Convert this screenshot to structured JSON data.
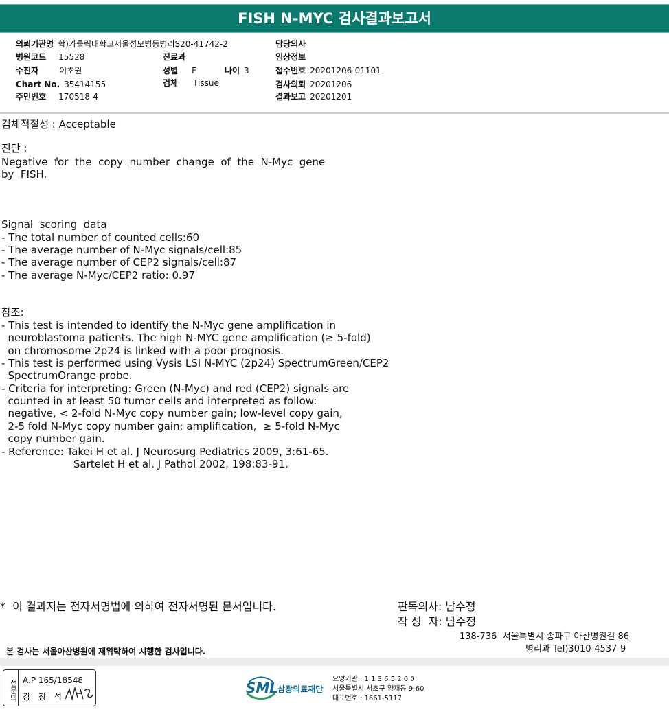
{
  "title": "FISH N-MYC 검사결과보고서",
  "info": {
    "req_inst_label": "의뢰기관명",
    "req_inst_value": "학)가톨릭대학교서울성모병동병리S20-41742-2",
    "hosp_code_label": "병원코드",
    "hosp_code_value": "15528",
    "patient_label": "수진자",
    "patient_value": "이초원",
    "chart_label": "Chart No.",
    "chart_value": "35414155",
    "id_label": "주민번호",
    "id_value": "170518-4",
    "dept_label": "진료과",
    "dept_value": "",
    "sex_label": "성별",
    "sex_value": "F",
    "age_label": "나이",
    "age_value": "3",
    "specimen_label": "검체",
    "specimen_value": "Tissue",
    "doctor_label": "담당의사",
    "doctor_value": "",
    "clinical_label": "임상정보",
    "clinical_value": "",
    "receipt_label": "접수번호",
    "receipt_value": "20201206-01101",
    "request_label": "검사의뢰",
    "request_value": "20201206",
    "report_label": "결과보고",
    "report_value": "20201201"
  },
  "body": {
    "adequacy": "검체적절성 : Acceptable",
    "diagnosis_label": "진단 :",
    "diagnosis_line1": "Negative  for  the  copy  number  change  of  the  N-Myc  gene",
    "diagnosis_line2": "by  FISH.",
    "signal_title": "Signal  scoring  data",
    "signal_1": "- The total number of counted cells:60",
    "signal_2": "- The average number of N-Myc signals/cell:85",
    "signal_3": "- The average number of CEP2 signals/cell:87",
    "signal_4": "- The average N-Myc/CEP2 ratio: 0.97",
    "ref_title": "참조:",
    "ref_1": "- This test is intended to identify the N-Myc gene amplification in",
    "ref_2": "  neuroblastoma patients. The high N-MYC gene amplification (≥ 5-fold)",
    "ref_3": "  on chromosome 2p24 is linked with a poor prognosis.",
    "ref_4": "- This test is performed using Vysis LSI N-MYC (2p24) SpectrumGreen/CEP2",
    "ref_5": "  SpectrumOrange probe.",
    "ref_6": "- Criteria for interpreting: Green (N-Myc) and red (CEP2) signals are",
    "ref_7": "  counted in at least 50 tumor cells and interpreted as follow:",
    "ref_8": "  negative, < 2-fold N-Myc copy number gain; low-level copy gain,",
    "ref_9": "  2-5 fold N-Myc copy number gain; amplification,  ≥ 5-fold N-Myc",
    "ref_10": "  copy number gain.",
    "ref_11": "- Reference: Takei H et al. J Neurosurg Pediatrics 2009, 3:61-65.",
    "ref_12": "                      Sartelet H et al. J Pathol 2002, 198:83-91."
  },
  "footer": {
    "esign_note": "*  이 결과지는 전자서명법에 의하여 전자서명된 문서입니다.",
    "reader": "판독의사: 남수정",
    "writer": "작 성  자: 남수정",
    "address": "138-736  서울특별시 송파구 아산병원길 86",
    "dept_tel": "병리과 Tel)3010-4537-9",
    "notice": "본 검사는 서울아산병원에 재위탁하여 시행한 검사입니다.",
    "stamp_side": "전문의",
    "stamp_ap": "A.P 165/18548",
    "stamp_name": "강 창 석",
    "logo_text": "SML",
    "logo_kr": "삼광의료재단",
    "org_code": "요양기관 : 1 1 3 6 5 2 0 0",
    "org_addr": "서울특별시 서초구 양재동 9-60",
    "org_tel": "대표번호 : 1661-5117"
  },
  "colors": {
    "title_bar": "#0b7a6e",
    "logo": "#0e6a92"
  }
}
